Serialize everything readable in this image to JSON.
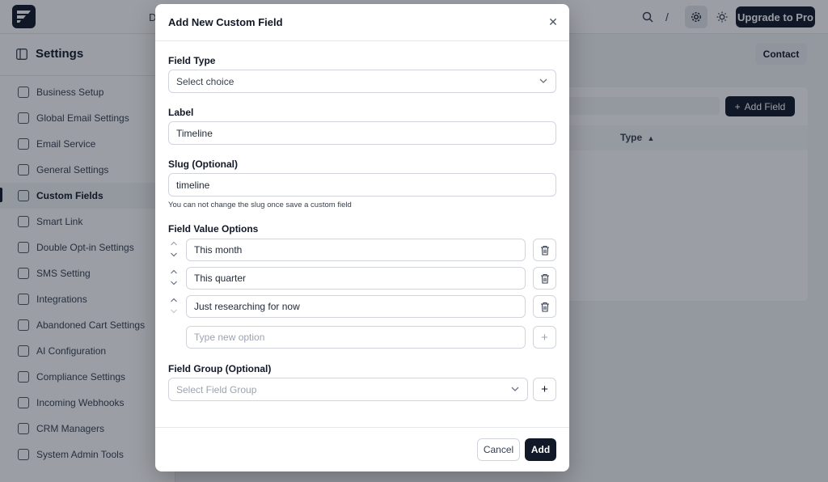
{
  "topbar": {
    "crumb": "D",
    "slash": "/",
    "upgrade_label": "Upgrade to Pro"
  },
  "sidebar": {
    "title": "Settings",
    "items": [
      {
        "label": "Business Setup",
        "icon": "briefcase-icon"
      },
      {
        "label": "Global Email Settings",
        "icon": "mail-settings-icon"
      },
      {
        "label": "Email Service",
        "icon": "mail-icon"
      },
      {
        "label": "General Settings",
        "icon": "sliders-icon"
      },
      {
        "label": "Custom Fields",
        "icon": "megaphone-icon",
        "active": true
      },
      {
        "label": "Smart Link",
        "icon": "link-icon"
      },
      {
        "label": "Double Opt-in Settings",
        "icon": "at-icon"
      },
      {
        "label": "SMS Setting",
        "icon": "message-icon"
      },
      {
        "label": "Integrations",
        "icon": "sliders-icon"
      },
      {
        "label": "Abandoned Cart Settings",
        "icon": "cart-icon"
      },
      {
        "label": "AI Configuration",
        "icon": "sparkle-icon"
      },
      {
        "label": "Compliance Settings",
        "icon": "check-circle-icon"
      },
      {
        "label": "Incoming Webhooks",
        "icon": "webhook-icon"
      },
      {
        "label": "CRM Managers",
        "icon": "users-icon"
      },
      {
        "label": "System Admin Tools",
        "icon": "info-icon"
      }
    ]
  },
  "background": {
    "contact_label": "Contact",
    "add_field_label": "Add Field",
    "type_column": "Type"
  },
  "modal": {
    "title": "Add New Custom Field",
    "field_type_label": "Field Type",
    "field_type_placeholder": "Select choice",
    "label_label": "Label",
    "label_value": "Timeline",
    "slug_label": "Slug (Optional)",
    "slug_value": "timeline",
    "slug_helper": "You can not change the slug once save a custom field",
    "options_label": "Field Value Options",
    "options": [
      "This month",
      "This quarter",
      "Just researching for now"
    ],
    "new_option_placeholder": "Type new option",
    "group_label": "Field Group (Optional)",
    "group_placeholder": "Select Field Group",
    "cancel_label": "Cancel",
    "add_label": "Add"
  },
  "colors": {
    "primary": "#111827",
    "overlay": "rgba(17,24,39,0.42)",
    "border": "#d1d5db"
  }
}
